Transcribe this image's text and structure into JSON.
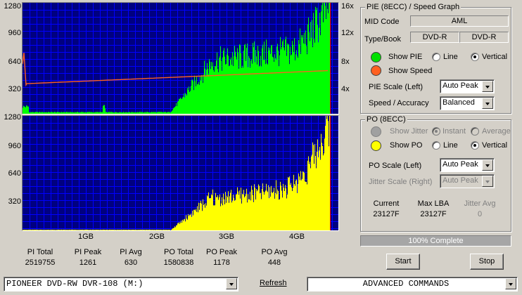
{
  "pie_graph": {
    "y_left_ticks": [
      "1280",
      "960",
      "640",
      "320"
    ],
    "y_right_ticks": [
      "16x",
      "12x",
      "8x",
      "4x"
    ]
  },
  "po_graph": {
    "y_left_ticks": [
      "1280",
      "960",
      "640",
      "320"
    ]
  },
  "x_ticks": [
    "1GB",
    "2GB",
    "3GB",
    "4GB"
  ],
  "stats": [
    {
      "label": "PI Total",
      "value": "2519755"
    },
    {
      "label": "PI Peak",
      "value": "1261"
    },
    {
      "label": "PI Avg",
      "value": "630"
    },
    {
      "label": "PO Total",
      "value": "1580838"
    },
    {
      "label": "PO Peak",
      "value": "1178"
    },
    {
      "label": "PO Avg",
      "value": "448"
    }
  ],
  "pie_panel": {
    "title": "PIE (8ECC) / Speed Graph",
    "mid_code_label": "MID Code",
    "mid_code_value": "AML",
    "type_book_label": "Type/Book",
    "type_value": "DVD-R",
    "book_value": "DVD-R",
    "show_pie_label": "Show PIE",
    "show_pie_color": "#00e000",
    "line_label": "Line",
    "vertical_label": "Vertical",
    "show_speed_label": "Show Speed",
    "show_speed_color": "#ff6020",
    "pie_scale_label": "PIE Scale (Left)",
    "pie_scale_value": "Auto Peak",
    "speed_accuracy_label": "Speed / Accuracy",
    "speed_accuracy_value": "Balanced"
  },
  "po_panel": {
    "title": "PO (8ECC)",
    "show_jitter_label": "Show Jitter",
    "instant_label": "Instant",
    "average_label": "Average",
    "show_po_label": "Show PO",
    "show_po_color": "#ffff00",
    "line_label": "Line",
    "vertical_label": "Vertical",
    "po_scale_label": "PO Scale (Left)",
    "po_scale_value": "Auto Peak",
    "jitter_scale_label": "Jitter Scale (Right)",
    "jitter_scale_value": "Auto Peak",
    "current_label": "Current",
    "current_value": "23127F",
    "max_lba_label": "Max LBA",
    "max_lba_value": "23127F",
    "jitter_avg_label": "Jitter Avg",
    "jitter_avg_value": "0"
  },
  "progress": {
    "text": "100% Complete",
    "fraction": 1.0
  },
  "buttons": {
    "start_label": "Start",
    "stop_label": "Stop"
  },
  "bottom_bar": {
    "drive_value": "PIONEER DVD-RW  DVR-108  (M:)",
    "refresh_label": "Refresh",
    "advanced_value": "ADVANCED COMMANDS"
  },
  "colors": {
    "graph_bg": "#000080",
    "grid": "#0000ff",
    "pie_fill": "#00ff00",
    "po_fill": "#ffff00",
    "speed_line": "#ff6020",
    "end_marker": "#ff0000"
  }
}
